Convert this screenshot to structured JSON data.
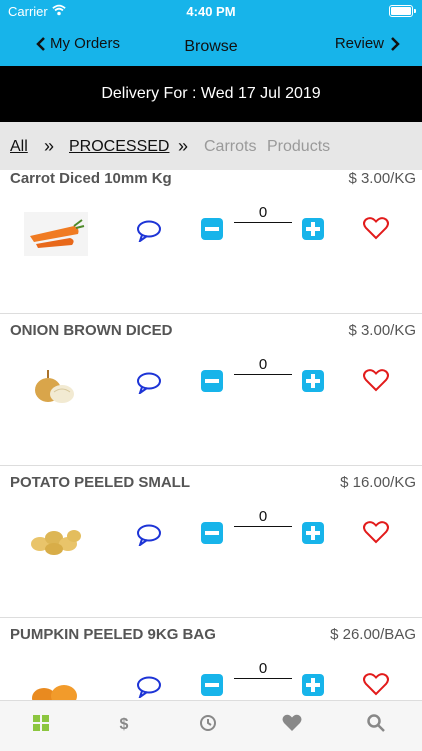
{
  "status_bar": {
    "carrier": "Carrier",
    "time": "4:40 PM"
  },
  "nav": {
    "back_label": "My Orders",
    "title": "Browse",
    "review_label": "Review"
  },
  "delivery": {
    "text": "Delivery For : Wed 17 Jul 2019"
  },
  "breadcrumb": {
    "all": "All",
    "sep1": "»",
    "processed": "PROCESSED",
    "sep2": "»",
    "carrots": "Carrots",
    "products": "Products"
  },
  "products": [
    {
      "name": "Carrot Diced 10mm Kg",
      "price": "$ 3.00/KG",
      "qty": "0",
      "image": "carrot-image"
    },
    {
      "name": "ONION BROWN DICED",
      "price": "$ 3.00/KG",
      "qty": "0",
      "image": "onion-image"
    },
    {
      "name": "POTATO PEELED SMALL",
      "price": "$ 16.00/KG",
      "qty": "0",
      "image": "potato-image"
    },
    {
      "name": "PUMPKIN PEELED 9KG BAG",
      "price": "$ 26.00/BAG",
      "qty": "0",
      "image": "pumpkin-image"
    }
  ],
  "tabbar": {
    "tabs": [
      {
        "name": "grid-icon",
        "symbol": "▦"
      },
      {
        "name": "dollar-icon",
        "symbol": "$"
      },
      {
        "name": "clock-icon",
        "symbol": "◷"
      },
      {
        "name": "heart-icon",
        "symbol": "♥"
      },
      {
        "name": "search-icon",
        "symbol": "⌕"
      }
    ],
    "active_color": "#8cc63f"
  },
  "colors": {
    "accent": "#17b4ea",
    "heart": "#e21b1b",
    "chat": "#1d34d6"
  }
}
